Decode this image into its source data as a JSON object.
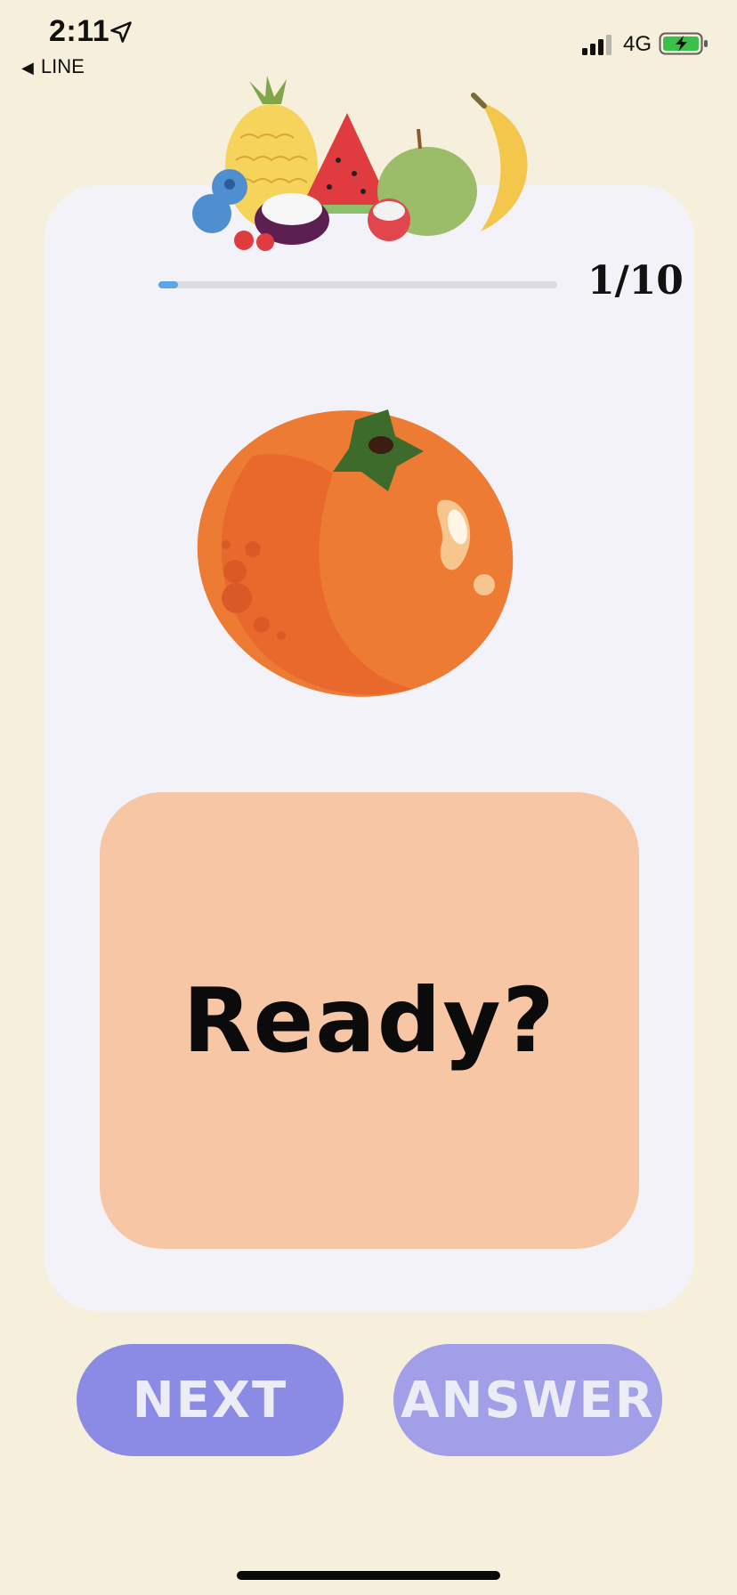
{
  "status_bar": {
    "time": "2:11",
    "back_app": "LINE",
    "network": "4G",
    "location_icon": "location-arrow-icon",
    "signal_icon": "cellular-signal-icon",
    "battery_icon": "battery-charging-icon"
  },
  "quiz": {
    "progress_text": "1/10",
    "progress_fraction": 0.1,
    "header_image": "fruit-characters-illustration",
    "question_image": "persimmon-illustration",
    "answer_text": "Ready?"
  },
  "buttons": {
    "next_label": "NEXT",
    "answer_label": "ANSWER"
  },
  "colors": {
    "background": "#f5efdb",
    "card": "#f3f2f8",
    "answer_box": "#f7c6a4",
    "next_button": "#8b8be6",
    "answer_button": "#a19fe8",
    "progress": "#5aa7e6"
  }
}
